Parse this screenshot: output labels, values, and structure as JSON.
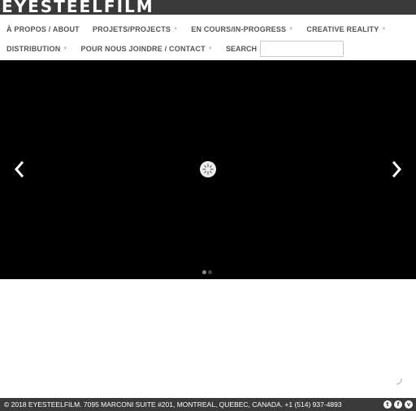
{
  "header": {
    "logo_text": "EYESTEELFILM"
  },
  "nav": {
    "row1": [
      {
        "label": "À PROPOS / ABOUT",
        "has_dropdown": false
      },
      {
        "label": "PROJETS/PROJECTS",
        "has_dropdown": true
      },
      {
        "label": "EN COURS/IN-PROGRESS",
        "has_dropdown": true
      },
      {
        "label": "CREATIVE REALITY",
        "has_dropdown": true
      }
    ],
    "row2": [
      {
        "label": "DISTRIBUTION",
        "has_dropdown": true
      },
      {
        "label": "POUR NOUS JOINDRE / CONTACT",
        "has_dropdown": true
      }
    ],
    "search": {
      "label": "SEARCH",
      "value": "",
      "placeholder": ""
    }
  },
  "slider": {
    "prev_icon": "chevron-left-icon",
    "next_icon": "chevron-right-icon",
    "loading_icon": "spinner-icon",
    "slide_count": 2,
    "active_slide": 1
  },
  "footer": {
    "text": "© 2018 EYESTEELFILM. 7095 MARCONI SUITE #201, MONTREAL, QUEBEC, CANADA. +1 (514) 937-4893",
    "social": [
      {
        "name": "twitter-icon",
        "glyph": "t"
      },
      {
        "name": "facebook-icon",
        "glyph": "f"
      },
      {
        "name": "vimeo-icon",
        "glyph": "v"
      }
    ]
  },
  "colors": {
    "bar_bg": "#3a3a3a",
    "nav_text": "#555555",
    "slider_bg": "#000000"
  }
}
